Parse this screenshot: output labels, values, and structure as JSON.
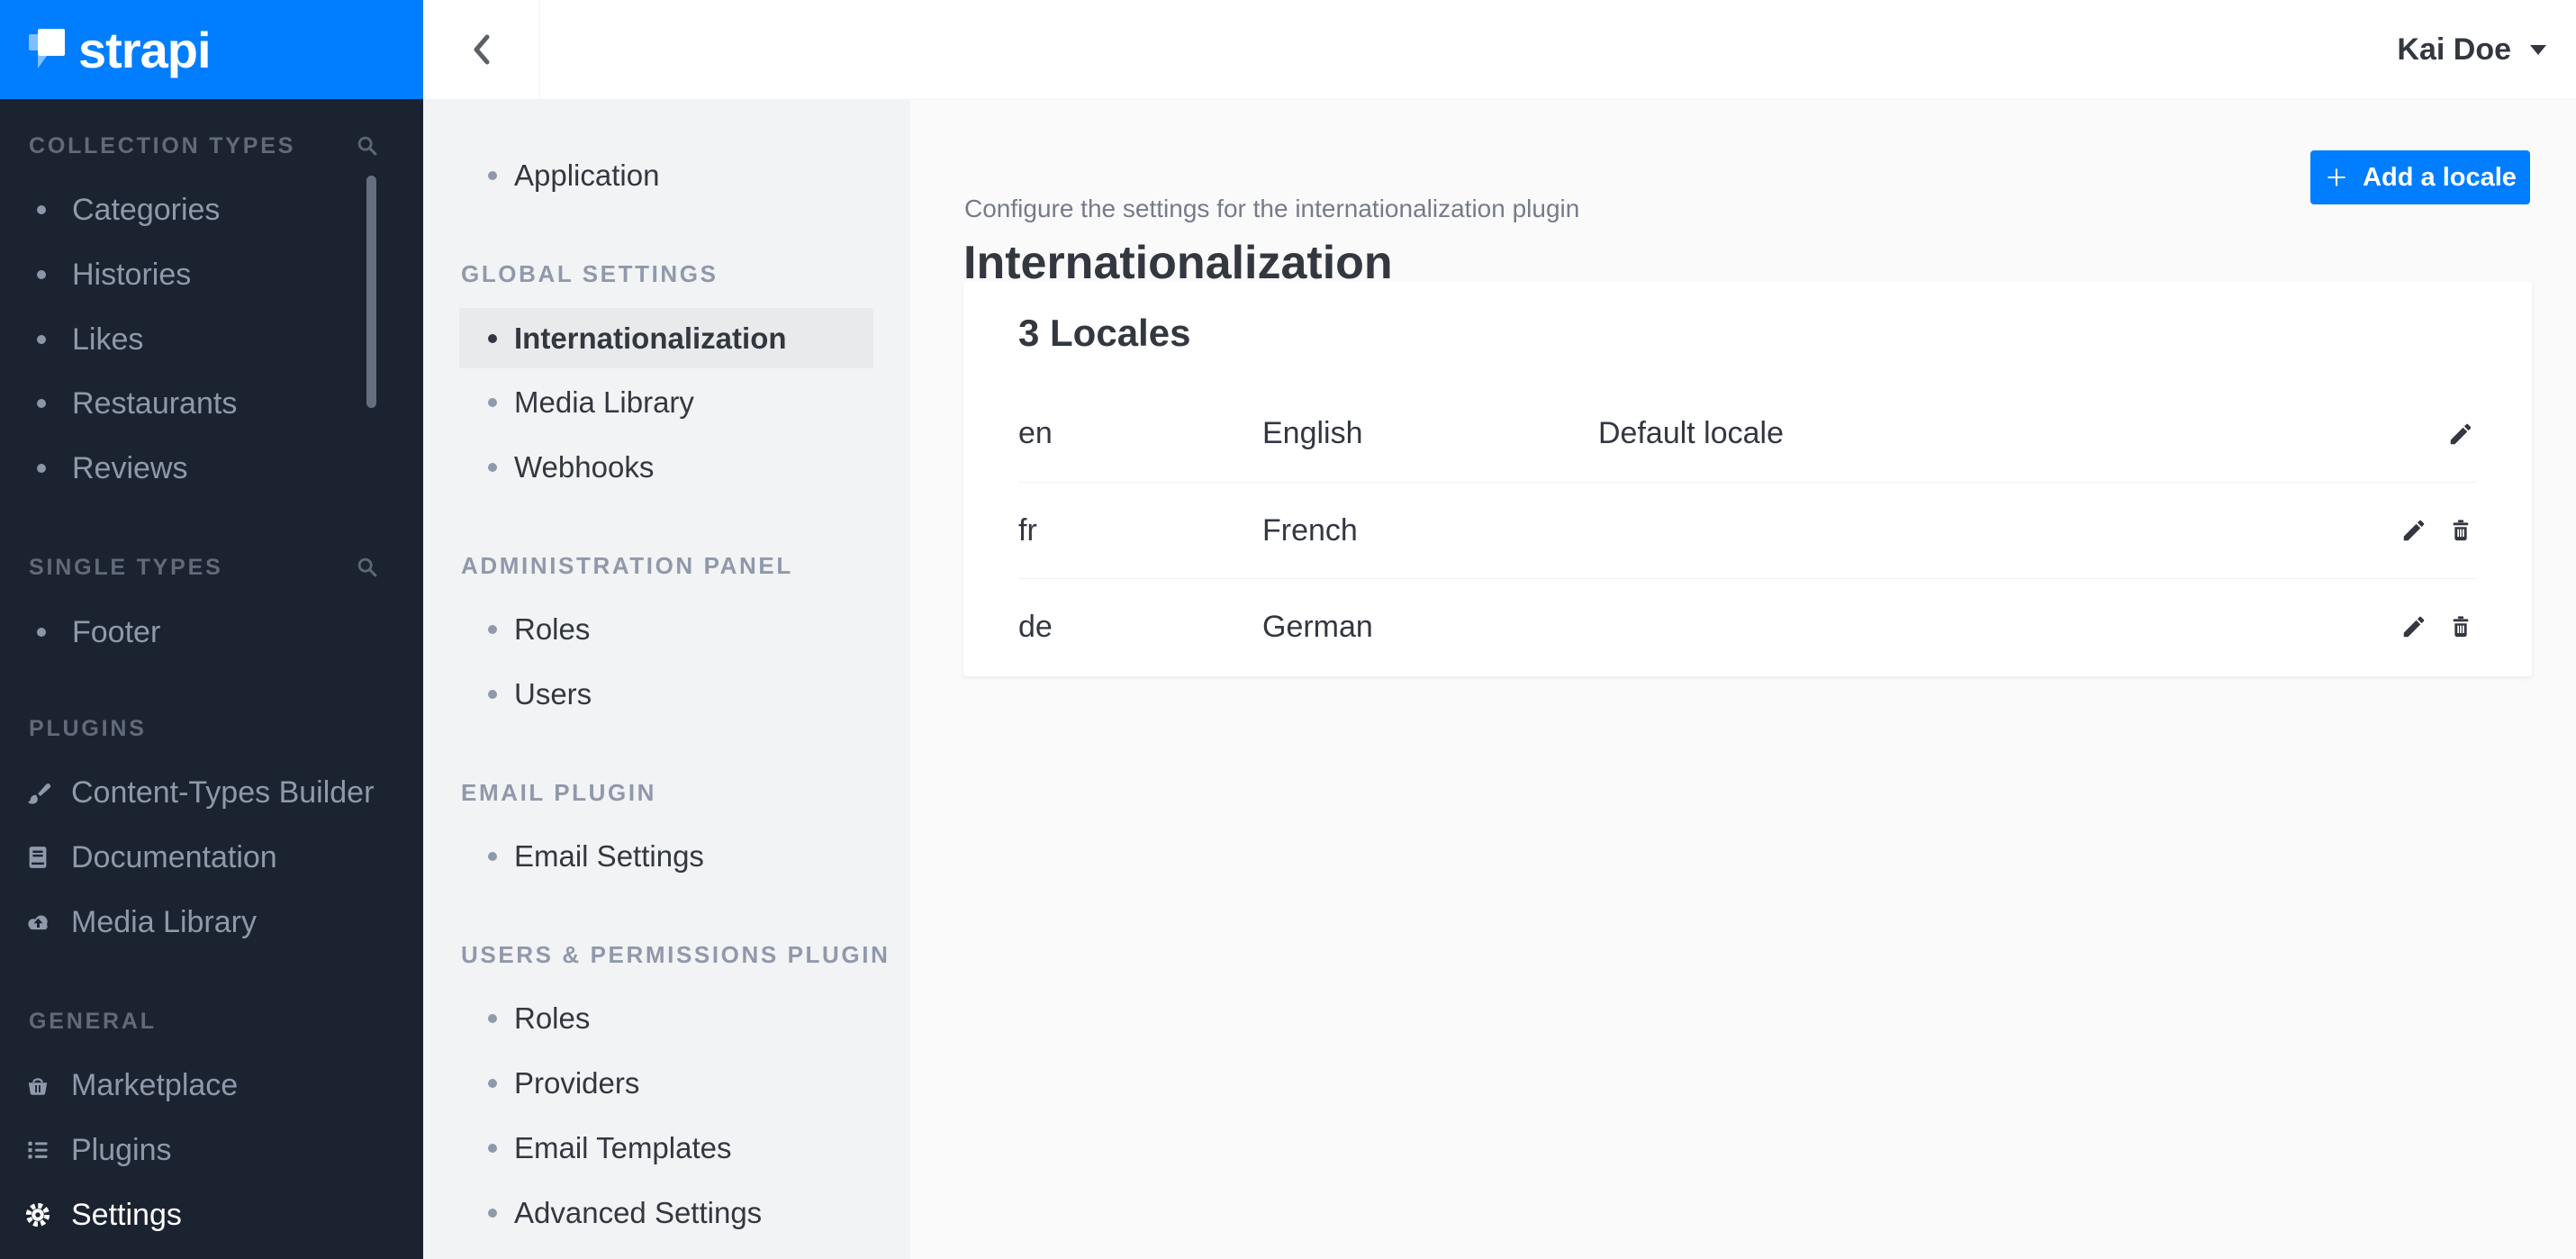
{
  "brand": {
    "wordmark": "strapi"
  },
  "main_menu": {
    "sections": [
      {
        "label": "COLLECTION TYPES",
        "items": [
          {
            "label": "Categories"
          },
          {
            "label": "Histories"
          },
          {
            "label": "Likes"
          },
          {
            "label": "Restaurants"
          },
          {
            "label": "Reviews"
          }
        ]
      },
      {
        "label": "SINGLE TYPES",
        "items": [
          {
            "label": "Footer"
          }
        ]
      },
      {
        "label": "PLUGINS",
        "items": [
          {
            "label": "Content-Types Builder"
          },
          {
            "label": "Documentation"
          },
          {
            "label": "Media Library"
          }
        ]
      },
      {
        "label": "GENERAL",
        "items": [
          {
            "label": "Marketplace"
          },
          {
            "label": "Plugins"
          },
          {
            "label": "Settings"
          }
        ]
      }
    ]
  },
  "settings_menu": {
    "application_label": "Application",
    "sections": [
      {
        "label": "GLOBAL SETTINGS",
        "items": [
          {
            "label": "Internationalization"
          },
          {
            "label": "Media Library"
          },
          {
            "label": "Webhooks"
          }
        ]
      },
      {
        "label": "ADMINISTRATION PANEL",
        "items": [
          {
            "label": "Roles"
          },
          {
            "label": "Users"
          }
        ]
      },
      {
        "label": "EMAIL PLUGIN",
        "items": [
          {
            "label": "Email Settings"
          }
        ]
      },
      {
        "label": "USERS & PERMISSIONS PLUGIN",
        "items": [
          {
            "label": "Roles"
          },
          {
            "label": "Providers"
          },
          {
            "label": "Email Templates"
          },
          {
            "label": "Advanced Settings"
          }
        ]
      }
    ]
  },
  "header": {
    "user_name": "Kai Doe"
  },
  "page": {
    "title": "Internationalization",
    "subtitle": "Configure the settings for the internationalization plugin",
    "add_button_label": "Add a locale"
  },
  "locales_card": {
    "title": "3 Locales",
    "rows": [
      {
        "code": "en",
        "name": "English",
        "note": "Default locale"
      },
      {
        "code": "fr",
        "name": "French",
        "note": ""
      },
      {
        "code": "de",
        "name": "German",
        "note": ""
      }
    ]
  },
  "colors": {
    "primary_blue": "#007eff",
    "menu_background": "#1c2330",
    "active_item_background": "#e9eaeb",
    "text_dark": "#333740"
  }
}
